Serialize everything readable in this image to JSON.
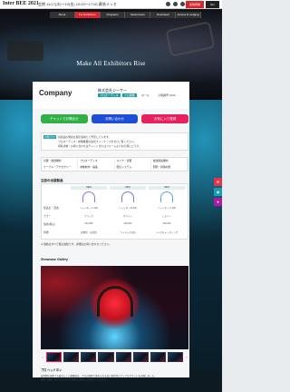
{
  "header": {
    "logo": "Inter BEE 2021",
    "dates": "会期 11/17(水)〜19(金) 10:00〜17:00 幕張メッセ",
    "register_label": "来場登録",
    "lang_label": "EN"
  },
  "nav": {
    "items": [
      "About",
      "For Exhibitors",
      "Programs",
      "News Items",
      "Download",
      "Access & Lodging"
    ],
    "active_index": 1
  },
  "hero": {
    "title": "Make All Exhibitors Rise"
  },
  "company": {
    "logo_text": "Company",
    "name": "株式会社ジーサー",
    "tags": [
      "プロオーディオ",
      "プロ映像"
    ],
    "booth_label": "ホール",
    "booth_number": "小間番号 1234"
  },
  "actions": {
    "chat": "チャットでお問合せ",
    "contact": "お問い合わせ",
    "favorite": "お気に入り登録"
  },
  "notice": {
    "tag": "お知らせ",
    "lines": [
      "新製品の発表を展示会場にて予定しています。",
      "プロオーディオ・映像機器の最新ラインナップをぜひご覧ください。",
      "資料請求・お問い合わせはチャットまたはフォームよりお気軽にどうぞ。"
    ]
  },
  "categories": [
    "音響・放送機材",
    "プロオーディオ",
    "マイク・音響",
    "放送関連機材",
    "ケーブル・アクセサリー",
    "映像制作・編集",
    "配信システム",
    "照明・特殊効果"
  ],
  "products": {
    "heading": "注目の出展製品",
    "row_labels": [
      "製品名・型番",
      "カラー",
      "価格(税込)",
      "特徴"
    ],
    "items": [
      {
        "badge": "NEW",
        "name": "ヘッドホン A-100",
        "color": "ブラック",
        "price": "¥12,800",
        "feature": "密閉型・高音質"
      },
      {
        "badge": "NEW",
        "name": "ヘッドホン B-200",
        "color": "ホワイト",
        "price": "¥18,800",
        "feature": "ワイヤレス対応"
      },
      {
        "badge": "NEW",
        "name": "ヘッドホン C-300",
        "color": "シルバー",
        "price": "¥24,800",
        "feature": "ノイズキャンセリング"
      }
    ],
    "note": "※ 価格はすべて税込価格です。詳細はお問い合わせください。"
  },
  "gallery": {
    "heading": "Showcase Gallery",
    "thumb_count": 8,
    "selected_index": 0,
    "prev": "‹",
    "next": "›"
  },
  "product_detail": {
    "title": "プロ ヘッドホン",
    "desc_line1": "長時間の使用でも疲れにくい軽量設計。プロの現場で求められる高い遮音性とクリアなサウンドを実現しました。",
    "desc_line2": "配信・収録・モニタリングなど幅広い用途にご利用いただけます。"
  },
  "colors": {
    "accent_red": "#d6262b",
    "btn_green": "#32b048",
    "btn_blue": "#1f4ed6",
    "btn_pink": "#e6215e",
    "tag_teal": "#1a9fb0"
  }
}
